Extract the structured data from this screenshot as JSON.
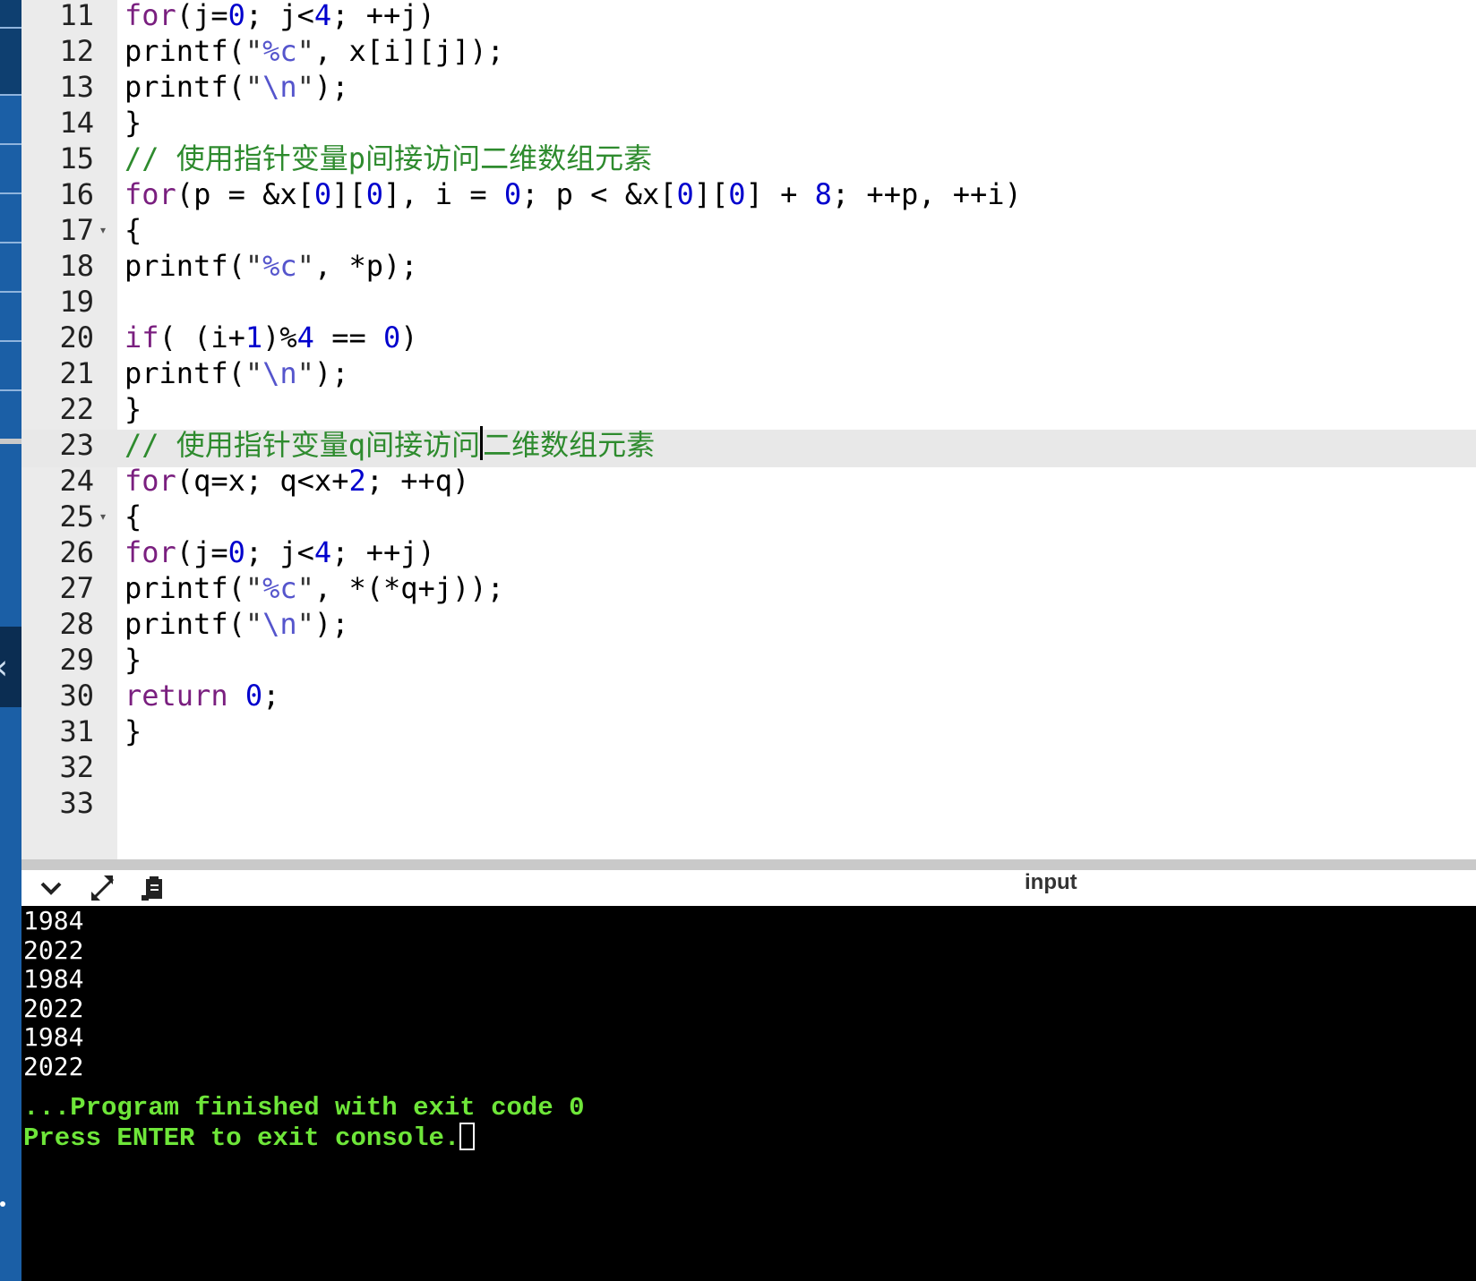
{
  "editor": {
    "active_line": "23",
    "lines": [
      {
        "num": "11",
        "parts": [
          [
            "kw",
            "for"
          ],
          [
            "p",
            "(j="
          ],
          [
            "num",
            "0"
          ],
          [
            "p",
            "; j<"
          ],
          [
            "num",
            "4"
          ],
          [
            "p",
            "; ++j)"
          ]
        ]
      },
      {
        "num": "12",
        "parts": [
          [
            "p",
            "printf("
          ],
          [
            "str",
            "\""
          ],
          [
            "fmt",
            "%c"
          ],
          [
            "str",
            "\""
          ],
          [
            "p",
            ", x[i][j]);"
          ]
        ]
      },
      {
        "num": "13",
        "parts": [
          [
            "p",
            "printf("
          ],
          [
            "str",
            "\""
          ],
          [
            "fmt",
            "\\n"
          ],
          [
            "str",
            "\""
          ],
          [
            "p",
            ");"
          ]
        ]
      },
      {
        "num": "14",
        "parts": [
          [
            "p",
            "}"
          ]
        ]
      },
      {
        "num": "15",
        "parts": [
          [
            "cmt",
            "// 使用指针变量p间接访问二维数组元素"
          ]
        ]
      },
      {
        "num": "16",
        "parts": [
          [
            "kw",
            "for"
          ],
          [
            "p",
            "(p = &x["
          ],
          [
            "num",
            "0"
          ],
          [
            "p",
            "]["
          ],
          [
            "num",
            "0"
          ],
          [
            "p",
            "], i = "
          ],
          [
            "num",
            "0"
          ],
          [
            "p",
            "; p < &x["
          ],
          [
            "num",
            "0"
          ],
          [
            "p",
            "]["
          ],
          [
            "num",
            "0"
          ],
          [
            "p",
            "] + "
          ],
          [
            "num",
            "8"
          ],
          [
            "p",
            "; ++p, ++i)"
          ]
        ]
      },
      {
        "num": "17",
        "fold": true,
        "parts": [
          [
            "p",
            "{"
          ]
        ]
      },
      {
        "num": "18",
        "parts": [
          [
            "p",
            "printf("
          ],
          [
            "str",
            "\""
          ],
          [
            "fmt",
            "%c"
          ],
          [
            "str",
            "\""
          ],
          [
            "p",
            ", *p);"
          ]
        ]
      },
      {
        "num": "19",
        "parts": []
      },
      {
        "num": "20",
        "parts": [
          [
            "kw",
            "if"
          ],
          [
            "p",
            "( (i+"
          ],
          [
            "num",
            "1"
          ],
          [
            "p",
            ")%"
          ],
          [
            "num",
            "4"
          ],
          [
            "p",
            " == "
          ],
          [
            "num",
            "0"
          ],
          [
            "p",
            ")"
          ]
        ]
      },
      {
        "num": "21",
        "parts": [
          [
            "p",
            "printf("
          ],
          [
            "str",
            "\""
          ],
          [
            "fmt",
            "\\n"
          ],
          [
            "str",
            "\""
          ],
          [
            "p",
            ");"
          ]
        ]
      },
      {
        "num": "22",
        "parts": [
          [
            "p",
            "}"
          ]
        ]
      },
      {
        "num": "23",
        "parts": [
          [
            "cmt",
            "// 使用指针变量q间接访问"
          ],
          [
            "cursor",
            ""
          ],
          [
            "cmt",
            "二维数组元素"
          ]
        ]
      },
      {
        "num": "24",
        "parts": [
          [
            "kw",
            "for"
          ],
          [
            "p",
            "(q=x; q<x+"
          ],
          [
            "num",
            "2"
          ],
          [
            "p",
            "; ++q)"
          ]
        ]
      },
      {
        "num": "25",
        "fold": true,
        "parts": [
          [
            "p",
            "{"
          ]
        ]
      },
      {
        "num": "26",
        "parts": [
          [
            "kw",
            "for"
          ],
          [
            "p",
            "(j="
          ],
          [
            "num",
            "0"
          ],
          [
            "p",
            "; j<"
          ],
          [
            "num",
            "4"
          ],
          [
            "p",
            "; ++j)"
          ]
        ]
      },
      {
        "num": "27",
        "parts": [
          [
            "p",
            "printf("
          ],
          [
            "str",
            "\""
          ],
          [
            "fmt",
            "%c"
          ],
          [
            "str",
            "\""
          ],
          [
            "p",
            ", *(*q+j));"
          ]
        ]
      },
      {
        "num": "28",
        "parts": [
          [
            "p",
            "printf("
          ],
          [
            "str",
            "\""
          ],
          [
            "fmt",
            "\\n"
          ],
          [
            "str",
            "\""
          ],
          [
            "p",
            ");"
          ]
        ]
      },
      {
        "num": "29",
        "parts": [
          [
            "p",
            "}"
          ]
        ]
      },
      {
        "num": "30",
        "parts": [
          [
            "kw",
            "return"
          ],
          [
            "p",
            " "
          ],
          [
            "num",
            "0"
          ],
          [
            "p",
            ";"
          ]
        ]
      },
      {
        "num": "31",
        "parts": [
          [
            "p",
            "}"
          ]
        ]
      },
      {
        "num": "32",
        "parts": []
      },
      {
        "num": "33",
        "parts": []
      }
    ]
  },
  "toolbar": {
    "collapse_icon": "chevron-down-icon",
    "expand_icon": "expand-arrows-icon",
    "copy_icon": "clipboard-icon",
    "input_label": "input"
  },
  "console": {
    "output": [
      "1984",
      "2022",
      "1984",
      "2022",
      "1984",
      "2022"
    ],
    "finished_message": "...Program finished with exit code 0",
    "exit_prompt": "Press ENTER to exit console."
  },
  "colors": {
    "keyword": "#7a1f7f",
    "number": "#0000cd",
    "comment": "#2e8b2e",
    "console_green": "#6ee639",
    "sidebar_blue": "#1b5fa6"
  }
}
